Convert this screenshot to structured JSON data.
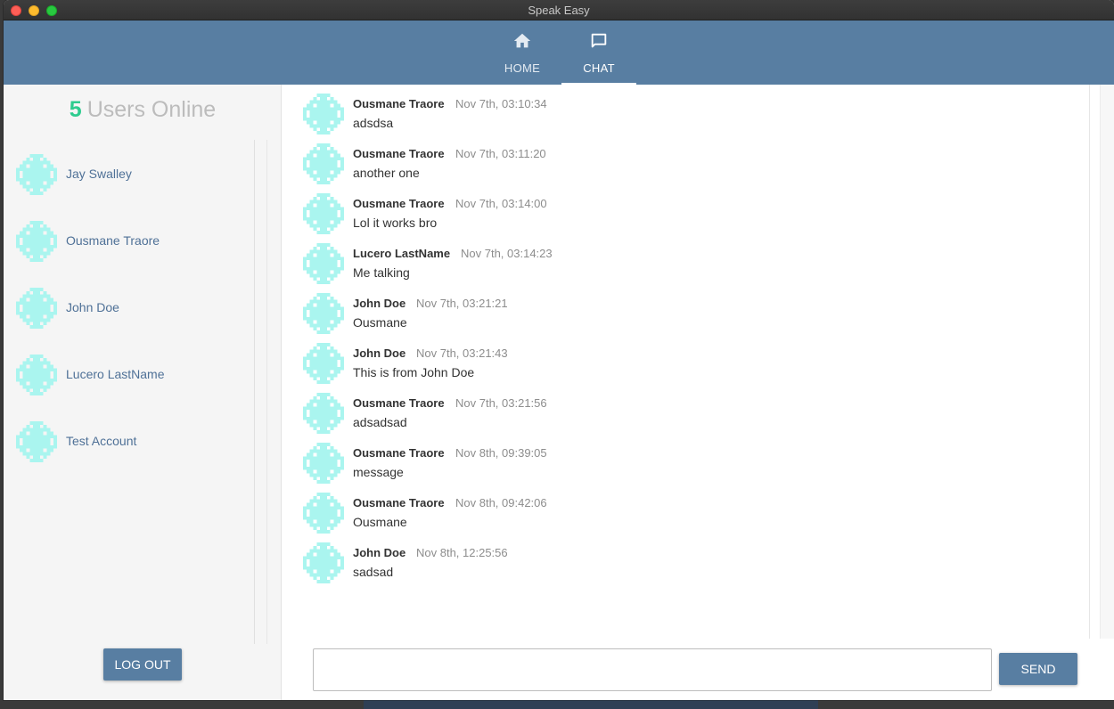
{
  "window": {
    "title": "Speak Easy"
  },
  "nav": {
    "tabs": [
      {
        "label": "HOME",
        "icon": "home-icon"
      },
      {
        "label": "CHAT",
        "icon": "chat-icon",
        "active": true
      }
    ]
  },
  "sidebar": {
    "online_count": "5",
    "online_label": "Users Online",
    "users": [
      {
        "name": "Jay Swalley"
      },
      {
        "name": "Ousmane Traore"
      },
      {
        "name": "John Doe"
      },
      {
        "name": "Lucero LastName"
      },
      {
        "name": "Test Account"
      }
    ],
    "logout_label": "LOG OUT"
  },
  "chat": {
    "messages": [
      {
        "author": "Ousmane Traore",
        "time": "Nov 7th, 03:10:34",
        "text": "adsdsa"
      },
      {
        "author": "Ousmane Traore",
        "time": "Nov 7th, 03:11:20",
        "text": "another one"
      },
      {
        "author": "Ousmane Traore",
        "time": "Nov 7th, 03:14:00",
        "text": "Lol it works bro"
      },
      {
        "author": "Lucero LastName",
        "time": "Nov 7th, 03:14:23",
        "text": "Me talking"
      },
      {
        "author": "John Doe",
        "time": "Nov 7th, 03:21:21",
        "text": "Ousmane"
      },
      {
        "author": "John Doe",
        "time": "Nov 7th, 03:21:43",
        "text": "This is from John Doe"
      },
      {
        "author": "Ousmane Traore",
        "time": "Nov 7th, 03:21:56",
        "text": "adsadsad"
      },
      {
        "author": "Ousmane Traore",
        "time": "Nov 8th, 09:39:05",
        "text": "message"
      },
      {
        "author": "Ousmane Traore",
        "time": "Nov 8th, 09:42:06",
        "text": "Ousmane"
      },
      {
        "author": "John Doe",
        "time": "Nov 8th, 12:25:56",
        "text": "sadsad"
      }
    ],
    "composer_value": "",
    "composer_placeholder": "",
    "send_label": "SEND"
  },
  "colors": {
    "brand": "#587ea2",
    "online_accent": "#2ecc8f",
    "avatar": "#aaf5ef"
  }
}
